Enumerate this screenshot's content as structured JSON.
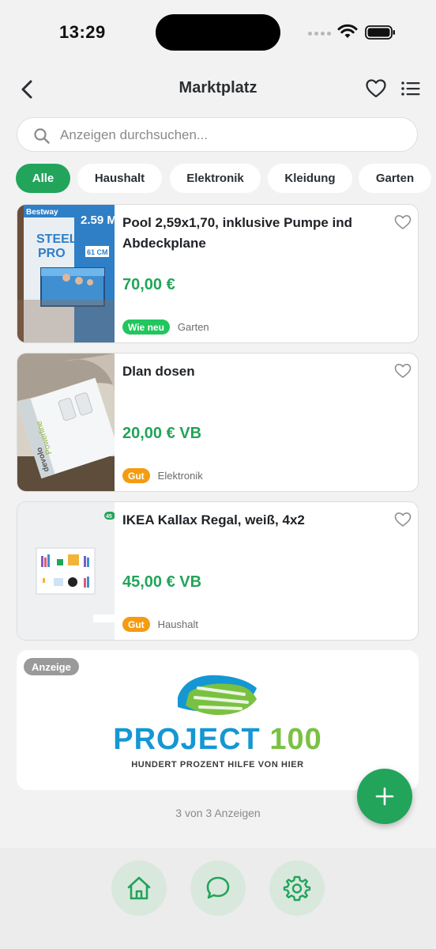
{
  "status_bar": {
    "time": "13:29"
  },
  "header": {
    "title": "Marktplatz"
  },
  "search": {
    "placeholder": "Anzeigen durchsuchen..."
  },
  "categories": [
    "Alle",
    "Haushalt",
    "Elektronik",
    "Kleidung",
    "Garten"
  ],
  "listings": [
    {
      "title": "Pool 2,59x1,70, inklusive Pumpe ind Abdeckplane",
      "price": "70,00 €",
      "condition": "Wie neu",
      "condition_color": "#22c55e",
      "category": "Garten",
      "image_text": {
        "brand": "Bestway",
        "size": "2.59 M",
        "product": "STEEL PRO",
        "height": "61 CM"
      }
    },
    {
      "title": "Dlan dosen",
      "price": "20,00 € VB",
      "condition": "Gut",
      "condition_color": "#f39c12",
      "category": "Elektronik",
      "image_text": {
        "brand": "devolo",
        "product": "Powerline"
      }
    },
    {
      "title": "IKEA Kallax Regal, weiß, 4x2",
      "price": "45,00 € VB",
      "condition": "Gut",
      "condition_color": "#f39c12",
      "category": "Haushalt",
      "image_text": {
        "badge": "45"
      }
    }
  ],
  "ad": {
    "label": "Anzeige",
    "brand_primary": "PROJECT",
    "brand_number": "100",
    "tagline": "HUNDERT PROZENT HILFE VON HIER"
  },
  "footer": {
    "count_text": "3 von 3 Anzeigen"
  },
  "colors": {
    "accent": "#22a45a",
    "background": "#f2f2f2"
  },
  "icons": [
    "back-arrow-icon",
    "heart-icon",
    "list-icon",
    "search-icon",
    "plus-icon",
    "home-icon",
    "chat-icon",
    "gear-icon"
  ]
}
